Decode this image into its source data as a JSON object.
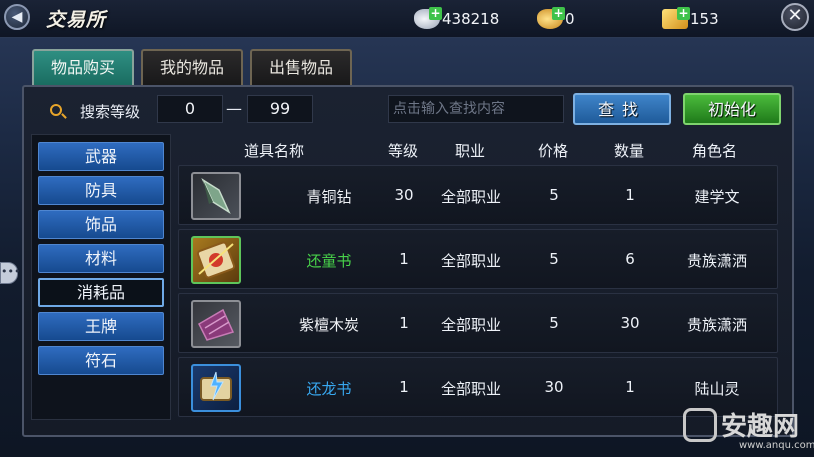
{
  "header": {
    "title": "交易所",
    "currencies": [
      {
        "icon": "silver-ingot-icon",
        "value": "438218"
      },
      {
        "icon": "gold-ingot-icon",
        "value": "0"
      },
      {
        "icon": "gold-coin-icon",
        "value": "153"
      }
    ]
  },
  "tabs": [
    {
      "label": "物品购买",
      "active": true
    },
    {
      "label": "我的物品",
      "active": false
    },
    {
      "label": "出售物品",
      "active": false
    }
  ],
  "search": {
    "level_label": "搜索等级",
    "level_min": "0",
    "dash": "—",
    "level_max": "99",
    "placeholder": "点击输入查找内容",
    "find_label": "查找",
    "reset_label": "初始化"
  },
  "categories": [
    {
      "label": "武器",
      "active": false
    },
    {
      "label": "防具",
      "active": false
    },
    {
      "label": "饰品",
      "active": false
    },
    {
      "label": "材料",
      "active": false
    },
    {
      "label": "消耗品",
      "active": true
    },
    {
      "label": "王牌",
      "active": false
    },
    {
      "label": "符石",
      "active": false
    }
  ],
  "table": {
    "columns": [
      "道具名称",
      "等级",
      "职业",
      "价格",
      "数量",
      "角色名"
    ],
    "rows": [
      {
        "icon": "bronze-drill-icon",
        "name": "青铜钻",
        "name_color": "#f0f2f6",
        "level": "30",
        "job": "全部职业",
        "price": "5",
        "qty": "1",
        "seller": "建学文"
      },
      {
        "icon": "scroll-green-icon",
        "name": "还童书",
        "name_color": "#48d24a",
        "level": "1",
        "job": "全部职业",
        "price": "5",
        "qty": "6",
        "seller": "贵族潇洒"
      },
      {
        "icon": "charcoal-icon",
        "name": "紫檀木炭",
        "name_color": "#f0f2f6",
        "level": "1",
        "job": "全部职业",
        "price": "5",
        "qty": "30",
        "seller": "贵族潇洒"
      },
      {
        "icon": "scroll-blue-icon",
        "name": "还龙书",
        "name_color": "#38a8f0",
        "level": "1",
        "job": "全部职业",
        "price": "30",
        "qty": "1",
        "seller": "陆山灵"
      }
    ]
  },
  "watermark": {
    "text": "安趣网",
    "url": "www.anqu.com"
  }
}
